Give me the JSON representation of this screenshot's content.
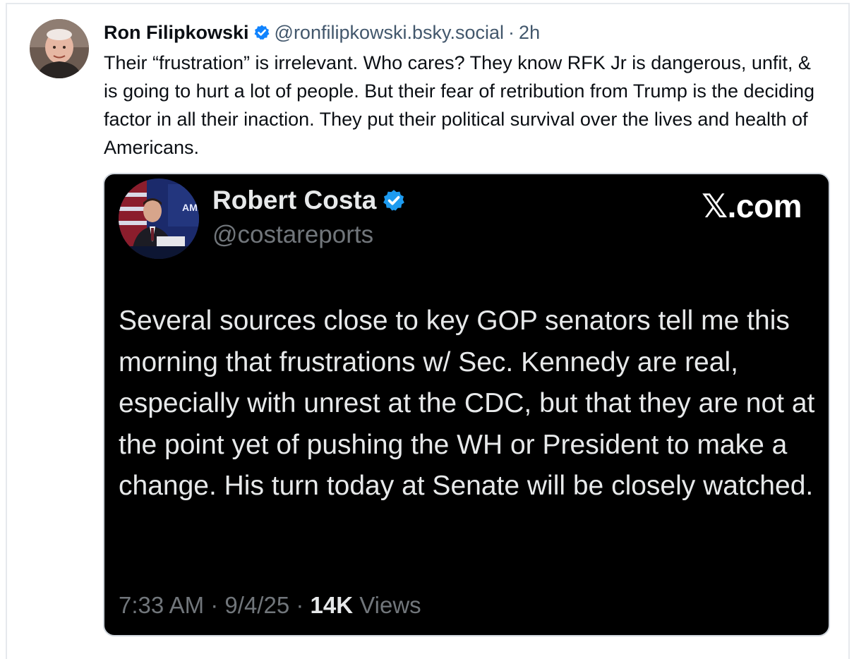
{
  "post": {
    "author_name": "Ron Filipkowski",
    "verified_icon": "verified-badge-icon",
    "handle": "@ronfilipkowski.bsky.social",
    "separator": "·",
    "time": "2h",
    "text": "Their “frustration” is irrelevant. Who cares? They know RFK Jr is dangerous, unfit, & is going to hurt a lot of people. But their fear of retribution from Trump is the deciding factor in all their inaction. They put their political survival over the lives and health of Americans."
  },
  "embed": {
    "author_name": "Robert Costa",
    "handle": "@costareports",
    "source_x": "𝕏",
    "source_suffix": ".com",
    "text": "Several sources close to key GOP senators tell me this morning that frustrations w/ Sec. Kennedy are real, especially with unrest at the CDC, but that they are not at the point yet of pushing the WH or President to make a change. His turn today at Senate will be closely watched.",
    "timestamp_time": "7:33 AM",
    "timestamp_date": "9/4/25",
    "separator": "·",
    "views_count": "14K",
    "views_label": "Views",
    "avatar_badge_text": "AME"
  },
  "colors": {
    "bluesky_verified": "#1083fe",
    "x_verified": "#1d9bf0",
    "embed_background": "#000000"
  }
}
